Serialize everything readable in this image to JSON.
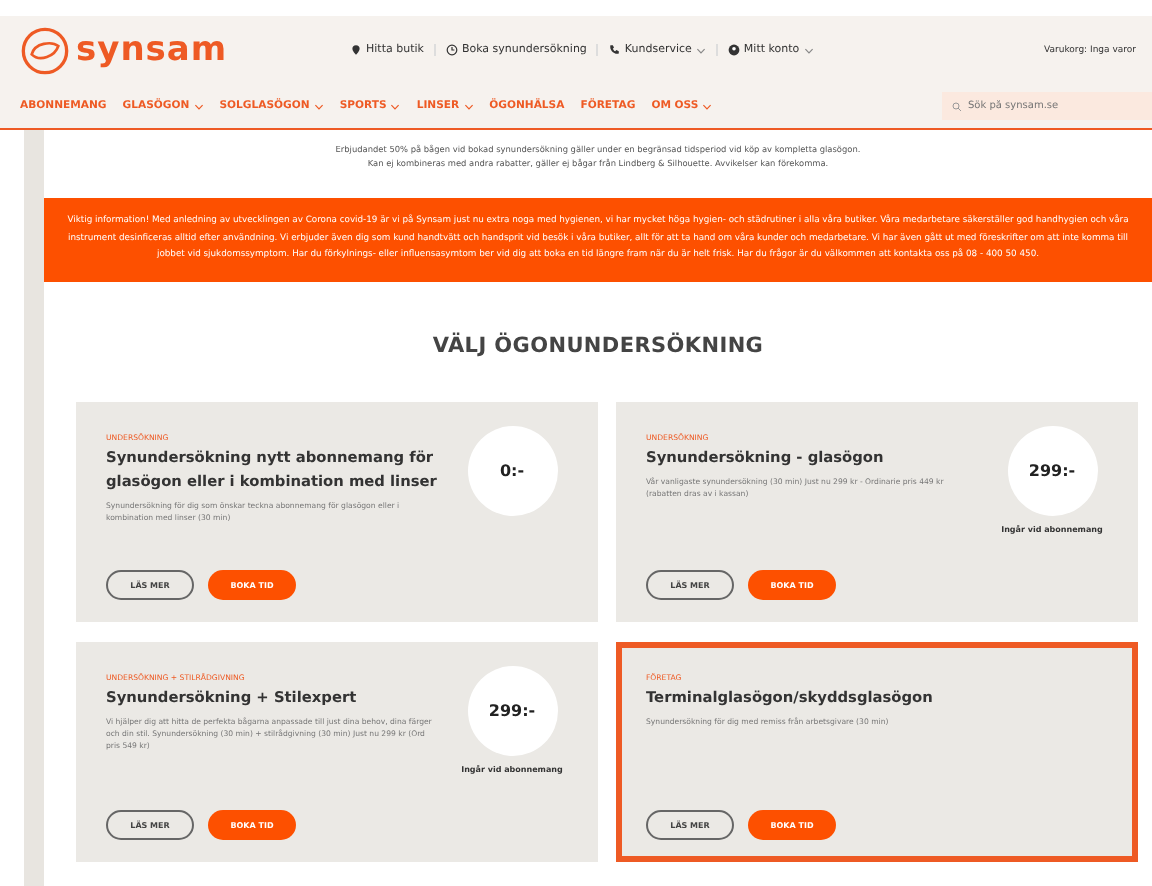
{
  "header": {
    "logo": "synsam",
    "top_links": [
      {
        "label": "Hitta butik",
        "has_menu": false
      },
      {
        "label": "Boka synundersökning",
        "has_menu": false
      },
      {
        "label": "Kundservice",
        "has_menu": true
      },
      {
        "label": "Mitt konto",
        "has_menu": true
      }
    ],
    "cart": "Varukorg: Inga varor"
  },
  "nav": {
    "items": [
      {
        "label": "ABONNEMANG",
        "has_menu": false
      },
      {
        "label": "GLASÖGON",
        "has_menu": true
      },
      {
        "label": "SOLGLASÖGON",
        "has_menu": true
      },
      {
        "label": "SPORTS",
        "has_menu": true
      },
      {
        "label": "LINSER",
        "has_menu": true
      },
      {
        "label": "ÖGONHÄLSA",
        "has_menu": false
      },
      {
        "label": "FÖRETAG",
        "has_menu": false
      },
      {
        "label": "OM OSS",
        "has_menu": true
      }
    ],
    "search": {
      "placeholder": "Sök på synsam.se"
    }
  },
  "intro": [
    "Erbjudandet 50% på bågen vid bokad synundersökning gäller under en begränsad tidsperiod vid köp av kompletta glasögon.",
    "Kan ej kombineras med andra rabatter, gäller ej bågar från Lindberg & Silhouette. Avvikelser kan förekomma."
  ],
  "notice": "Viktig information! Med anledning av utvecklingen av Corona covid-19 är vi på Synsam just nu extra noga med hygienen, vi har mycket höga hygien- och städrutiner i alla våra butiker. Våra medarbetare säkerställer god handhygien och våra instrument desinficeras alltid efter användning. Vi erbjuder även dig som kund handtvätt och handsprit vid besök i våra butiker, allt för att ta hand om våra kunder och medarbetare. Vi har även gått ut med föreskrifter om att inte komma till jobbet vid sjukdomssymptom. Har du förkylnings- eller influensasymtom ber vid dig att boka en tid längre fram när du är helt frisk. Har du frågor är du välkommen att kontakta oss på 08 - 400 50 450.",
  "heading": "VÄLJ ÖGONUNDERSÖKNING",
  "cards": [
    {
      "category": "UNDERSÖKNING",
      "title": "Synundersökning nytt abonnemang för glasögon eller i kombination med linser",
      "description": "Synundersökning för dig som önskar teckna abonnemang för glasögon eller i kombination med linser (30 min)",
      "price": "0:-",
      "buttons": [
        "LÄS MER",
        "BOKA TID"
      ],
      "selected": false
    },
    {
      "category": "UNDERSÖKNING",
      "title": "Synundersökning - glasögon",
      "description": "Vår vanligaste synundersökning (30 min) Just nu 299 kr - Ordinarie pris 449 kr (rabatten dras av i kassan)",
      "price": "299:-",
      "price_note": "Ingår vid abonnemang",
      "buttons": [
        "LÄS MER",
        "BOKA TID"
      ],
      "selected": false
    },
    {
      "category": "UNDERSÖKNING + STILRÅDGIVNING",
      "title": "Synundersökning + Stilexpert",
      "description": "Vi hjälper dig att hitta de perfekta bågarna anpassade till just dina behov, dina färger och din stil. Synundersökning (30 min) + stilrådgivning (30 min) Just nu 299 kr (Ord pris 549 kr)",
      "price": "299:-",
      "price_note": "Ingår vid abonnemang",
      "buttons": [
        "LÄS MER",
        "BOKA TID"
      ],
      "selected": false
    },
    {
      "category": "FÖRETAG",
      "title": "Terminalglasögon/skyddsglasögon",
      "description": "Synundersökning för dig med remiss från arbetsgivare (30 min)",
      "buttons": [
        "LÄS MER",
        "BOKA TID"
      ],
      "selected": true
    }
  ]
}
